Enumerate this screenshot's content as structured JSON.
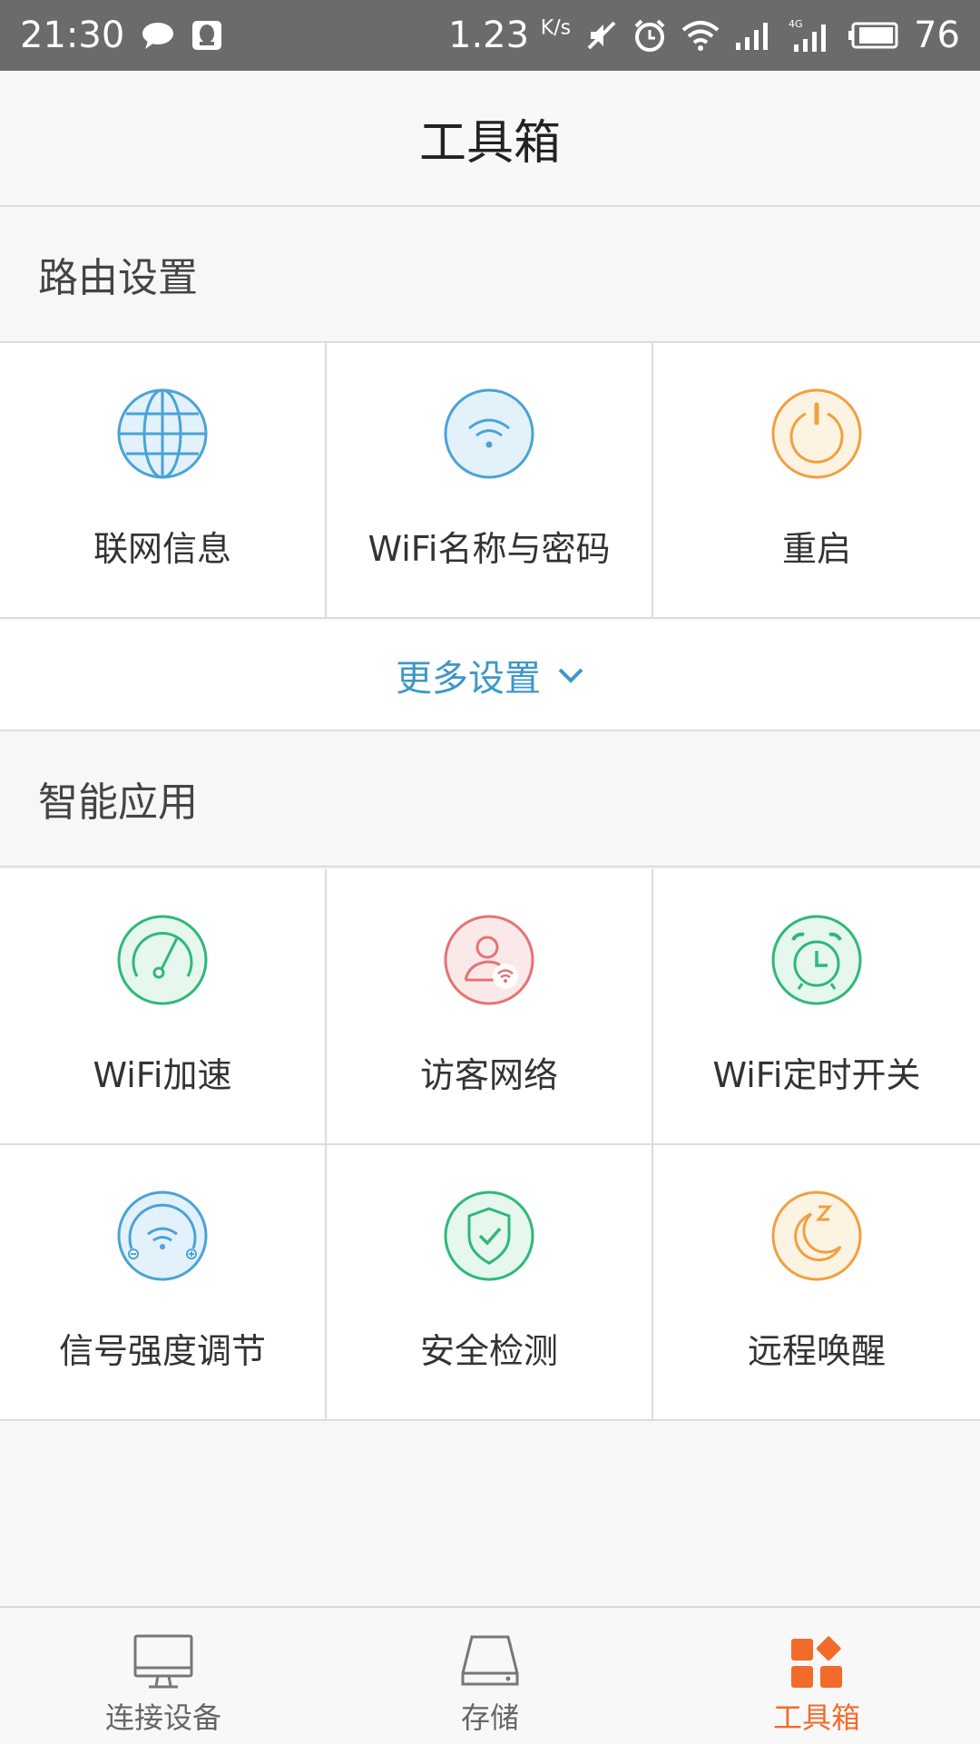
{
  "status_bar": {
    "time": "21:30",
    "net_speed": "1.23",
    "net_unit": "K/s",
    "battery": "76",
    "network_type": "4G"
  },
  "header": {
    "title": "工具箱"
  },
  "router_settings": {
    "title": "路由设置",
    "items": [
      {
        "label": "联网信息",
        "icon": "globe-icon",
        "color": "#4aa3d6"
      },
      {
        "label": "WiFi名称与密码",
        "icon": "wifi-icon",
        "color": "#4aa3d6"
      },
      {
        "label": "重启",
        "icon": "power-icon",
        "color": "#f0a040"
      }
    ],
    "more_label": "更多设置"
  },
  "smart_apps": {
    "title": "智能应用",
    "items": [
      {
        "label": "WiFi加速",
        "icon": "speedometer-icon",
        "color": "#2fb878"
      },
      {
        "label": "访客网络",
        "icon": "guest-user-icon",
        "color": "#e57373"
      },
      {
        "label": "WiFi定时开关",
        "icon": "alarm-clock-icon",
        "color": "#2fb878"
      },
      {
        "label": "信号强度调节",
        "icon": "signal-strength-icon",
        "color": "#4aa3d6"
      },
      {
        "label": "安全检测",
        "icon": "shield-check-icon",
        "color": "#2fb878"
      },
      {
        "label": "远程唤醒",
        "icon": "moon-sleep-icon",
        "color": "#f0a040"
      }
    ]
  },
  "tab_bar": {
    "items": [
      {
        "label": "连接设备",
        "icon": "monitor-icon",
        "active": false
      },
      {
        "label": "存储",
        "icon": "storage-drive-icon",
        "active": false
      },
      {
        "label": "工具箱",
        "icon": "toolbox-grid-icon",
        "active": true
      }
    ],
    "active_color": "#f26b2a"
  }
}
